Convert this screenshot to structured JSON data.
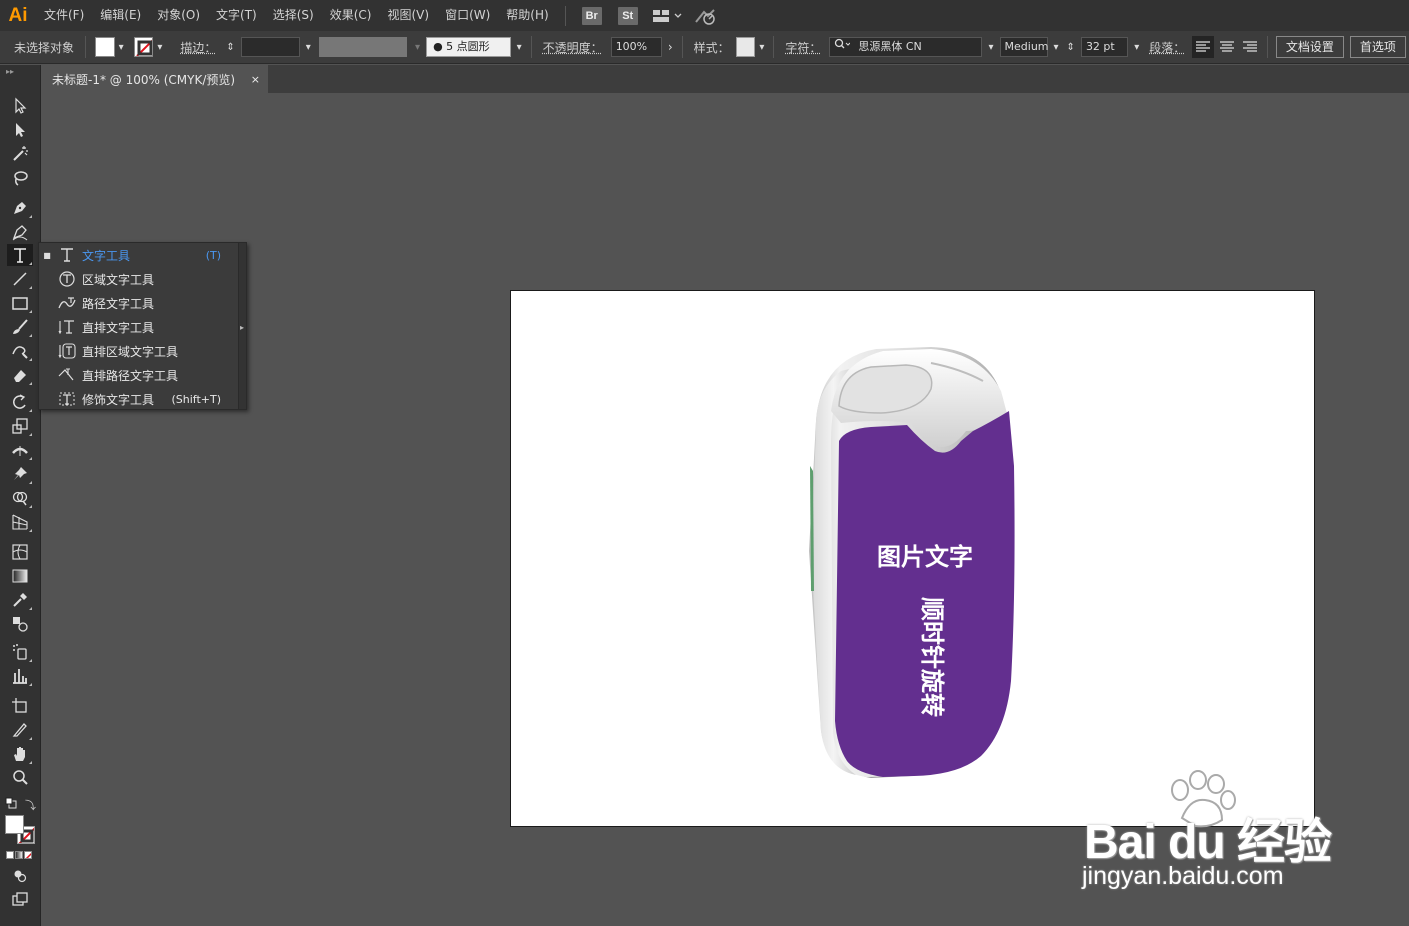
{
  "app": {
    "logo": "Ai"
  },
  "menu": {
    "items": [
      "文件(F)",
      "编辑(E)",
      "对象(O)",
      "文字(T)",
      "选择(S)",
      "效果(C)",
      "视图(V)",
      "窗口(W)",
      "帮助(H)"
    ],
    "bridge_badge": "Br",
    "stock_badge": "St"
  },
  "control": {
    "no_selection": "未选择对象",
    "stroke_label": "描边：",
    "brush_value": "5 点圆形",
    "opacity_label": "不透明度：",
    "opacity_value": "100%",
    "style_label": "样式：",
    "char_label": "字符：",
    "font_name": "思源黑体 CN",
    "font_weight": "Medium",
    "font_size": "32 pt",
    "para_label": "段落：",
    "doc_setup": "文档设置",
    "prefs": "首选项"
  },
  "tab": {
    "title": "未标题-1* @ 100% (CMYK/预览)",
    "close": "×"
  },
  "flyout": [
    {
      "label": "文字工具",
      "key": "(T)",
      "selected": true
    },
    {
      "label": "区域文字工具",
      "key": ""
    },
    {
      "label": "路径文字工具",
      "key": ""
    },
    {
      "label": "直排文字工具",
      "key": ""
    },
    {
      "label": "直排区域文字工具",
      "key": ""
    },
    {
      "label": "直排路径文字工具",
      "key": ""
    },
    {
      "label": "修饰文字工具",
      "key": "(Shift+T)"
    }
  ],
  "artwork": {
    "horizontal_text": "图片文字",
    "vertical_text": "顺时针旋转",
    "label_color": "#632f8f"
  },
  "watermark": {
    "main": "Bai du 经验",
    "url": "jingyan.baidu.com"
  }
}
